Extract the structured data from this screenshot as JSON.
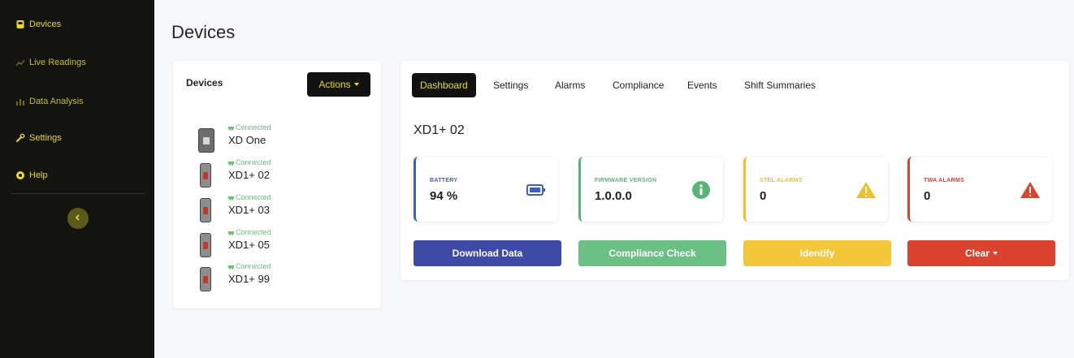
{
  "colors": {
    "brand_yellow": "#e9dc22",
    "sidebar_bg": "#131311",
    "connected_green": "#6cbf7a",
    "battery_blue": "#3d5fc4",
    "firmware_green": "#5cb37a",
    "stel_yellow": "#f0c02a",
    "twa_red": "#d9432f"
  },
  "sidebar": {
    "items": [
      {
        "label": "Devices",
        "icon": "device-icon"
      },
      {
        "label": "Live Readings",
        "icon": "chart-line-icon"
      },
      {
        "label": "Data Analysis",
        "icon": "bar-chart-icon"
      },
      {
        "label": "Settings",
        "icon": "wrench-icon"
      },
      {
        "label": "Help",
        "icon": "help-circle-icon"
      }
    ],
    "collapse_icon": "chevron-left-icon"
  },
  "page": {
    "title": "Devices"
  },
  "devices_panel": {
    "title": "Devices",
    "actions_label": "Actions",
    "devices": [
      {
        "status": "Connected",
        "name": "XD One"
      },
      {
        "status": "Connected",
        "name": "XD1+ 02"
      },
      {
        "status": "Connected",
        "name": "XD1+ 03"
      },
      {
        "status": "Connected",
        "name": "XD1+ 05"
      },
      {
        "status": "Connected",
        "name": "XD1+ 99"
      }
    ]
  },
  "detail": {
    "tabs": [
      "Dashboard",
      "Settings",
      "Alarms",
      "Compliance",
      "Events",
      "Shift Summaries"
    ],
    "active_tab": "Dashboard",
    "device_name": "XD1+ 02",
    "cards": [
      {
        "label": "BATTERY",
        "value": "94 %",
        "icon": "battery-icon"
      },
      {
        "label": "FIRMWARE VERSION",
        "value": "1.0.0.0",
        "icon": "info-icon"
      },
      {
        "label": "STEL ALARMS",
        "value": "0",
        "icon": "warning-icon"
      },
      {
        "label": "TWA ALARMS",
        "value": "0",
        "icon": "warning-icon"
      }
    ],
    "buttons": {
      "download": "Download Data",
      "compliance": "Compliance Check",
      "identify": "Identify",
      "clear": "Clear"
    }
  }
}
